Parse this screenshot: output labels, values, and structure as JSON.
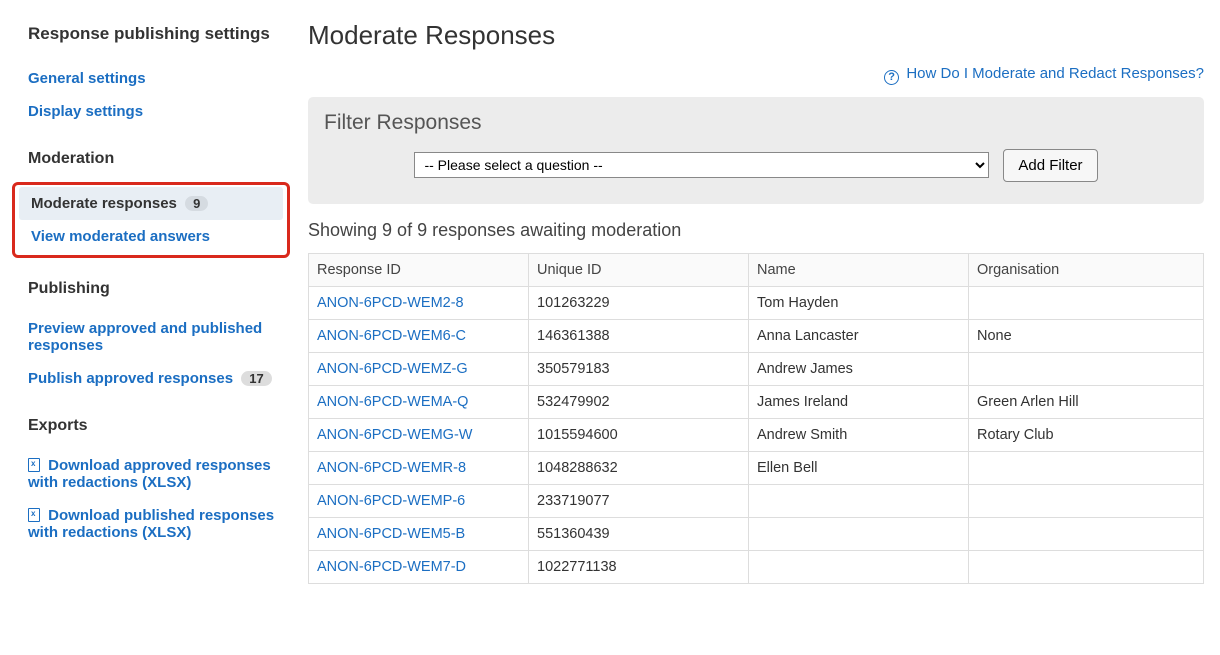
{
  "sidebar": {
    "section_settings_title": "Response publishing settings",
    "links_settings": [
      {
        "label": "General settings"
      },
      {
        "label": "Display settings"
      }
    ],
    "section_moderation_title": "Moderation",
    "moderation_items": [
      {
        "label": "Moderate responses",
        "badge": "9",
        "active": true
      },
      {
        "label": "View moderated answers",
        "active": false
      }
    ],
    "section_publishing_title": "Publishing",
    "publishing_items": [
      {
        "label": "Preview approved and published responses"
      },
      {
        "label": "Publish approved responses",
        "badge": "17"
      }
    ],
    "section_exports_title": "Exports",
    "exports_items": [
      {
        "label": "Download approved responses with redactions (XLSX)"
      },
      {
        "label": "Download published responses with redactions (XLSX)"
      }
    ]
  },
  "main": {
    "title": "Moderate Responses",
    "help_link": "How Do I Moderate and Redact Responses?",
    "filter": {
      "title": "Filter Responses",
      "select_placeholder": "-- Please select a question --",
      "button": "Add Filter"
    },
    "showing_text": "Showing 9 of 9 responses awaiting moderation",
    "table": {
      "headers": {
        "response_id": "Response ID",
        "unique_id": "Unique ID",
        "name": "Name",
        "organisation": "Organisation"
      },
      "rows": [
        {
          "response_id": "ANON-6PCD-WEM2-8",
          "unique_id": "101263229",
          "name": "Tom Hayden",
          "organisation": ""
        },
        {
          "response_id": "ANON-6PCD-WEM6-C",
          "unique_id": "146361388",
          "name": "Anna Lancaster",
          "organisation": "None"
        },
        {
          "response_id": "ANON-6PCD-WEMZ-G",
          "unique_id": "350579183",
          "name": "Andrew James",
          "organisation": ""
        },
        {
          "response_id": "ANON-6PCD-WEMA-Q",
          "unique_id": "532479902",
          "name": "James Ireland",
          "organisation": "Green Arlen Hill"
        },
        {
          "response_id": "ANON-6PCD-WEMG-W",
          "unique_id": "1015594600",
          "name": "Andrew Smith",
          "organisation": "Rotary Club"
        },
        {
          "response_id": "ANON-6PCD-WEMR-8",
          "unique_id": "1048288632",
          "name": "Ellen Bell",
          "organisation": ""
        },
        {
          "response_id": "ANON-6PCD-WEMP-6",
          "unique_id": "233719077",
          "name": "",
          "organisation": ""
        },
        {
          "response_id": "ANON-6PCD-WEM5-B",
          "unique_id": "551360439",
          "name": "",
          "organisation": ""
        },
        {
          "response_id": "ANON-6PCD-WEM7-D",
          "unique_id": "1022771138",
          "name": "",
          "organisation": ""
        }
      ]
    }
  }
}
